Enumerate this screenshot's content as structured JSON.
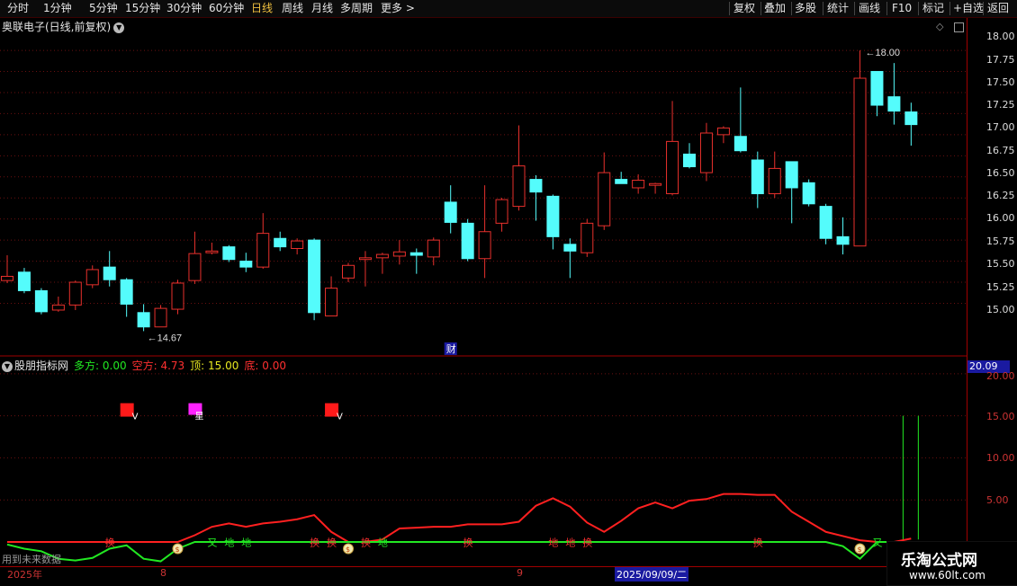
{
  "toolbar": {
    "periods": [
      "分时",
      "1分钟",
      "5分钟",
      "15分钟",
      "30分钟",
      "60分钟",
      "日线",
      "周线",
      "月线",
      "多周期",
      "更多 >"
    ],
    "active_period": "日线",
    "right_buttons": [
      "复权",
      "叠加",
      "多股",
      "统计",
      "画线",
      "F10",
      "标记",
      "+自选",
      "返回"
    ]
  },
  "stock": {
    "title": "奥联电子(日线,前复权)"
  },
  "price_axis": {
    "labels": [
      "18.00",
      "17.75",
      "17.50",
      "17.25",
      "17.00",
      "16.75",
      "16.50",
      "16.25",
      "16.00",
      "15.75",
      "15.50",
      "15.25",
      "15.00"
    ]
  },
  "annotations": {
    "high": "18.00",
    "low": "14.67",
    "finance_badge": "财"
  },
  "indicator": {
    "name": "股朋指标网",
    "duo": "多方: 0.00",
    "kong": "空方: 4.73",
    "ding": "顶: 15.00",
    "di": "底: 0.00",
    "current_value": "20.09",
    "axis_labels": [
      "20.00",
      "15.00",
      "10.00",
      "5.00"
    ],
    "markers": [
      "V",
      "星",
      "V"
    ],
    "signals": [
      "换",
      "又",
      "地",
      "地",
      "换",
      "换",
      "换",
      "地",
      "换",
      "地",
      "地",
      "换",
      "换",
      "又"
    ]
  },
  "footer": {
    "future_data": "用到未来数据",
    "year": "2025年",
    "month8": "8",
    "month9": "9",
    "selected_date": "2025/09/09/二"
  },
  "watermark": {
    "name": "乐淘公式网",
    "url": "www.60lt.com"
  },
  "colors": {
    "up": "#e8302c",
    "down": "#54fcfc",
    "kong_line": "#ff2020",
    "duo_line": "#22e822",
    "grid": "#6a1010"
  },
  "chart_data": {
    "type": "candlestick",
    "candles": [
      {
        "o": 15.27,
        "h": 15.57,
        "l": 15.24,
        "c": 15.32
      },
      {
        "o": 15.37,
        "h": 15.42,
        "l": 15.12,
        "c": 15.15
      },
      {
        "o": 15.15,
        "h": 15.18,
        "l": 14.87,
        "c": 14.9
      },
      {
        "o": 14.92,
        "h": 15.08,
        "l": 14.9,
        "c": 14.98
      },
      {
        "o": 14.98,
        "h": 15.27,
        "l": 14.92,
        "c": 15.25
      },
      {
        "o": 15.22,
        "h": 15.45,
        "l": 15.18,
        "c": 15.4
      },
      {
        "o": 15.43,
        "h": 15.62,
        "l": 15.2,
        "c": 15.28
      },
      {
        "o": 15.28,
        "h": 15.3,
        "l": 14.84,
        "c": 14.99
      },
      {
        "o": 14.89,
        "h": 14.99,
        "l": 14.67,
        "c": 14.72
      },
      {
        "o": 14.72,
        "h": 14.98,
        "l": 14.72,
        "c": 14.94
      },
      {
        "o": 14.93,
        "h": 15.28,
        "l": 14.87,
        "c": 15.24
      },
      {
        "o": 15.27,
        "h": 15.85,
        "l": 15.23,
        "c": 15.59
      },
      {
        "o": 15.6,
        "h": 15.72,
        "l": 15.58,
        "c": 15.62
      },
      {
        "o": 15.67,
        "h": 15.69,
        "l": 15.49,
        "c": 15.52
      },
      {
        "o": 15.5,
        "h": 15.6,
        "l": 15.37,
        "c": 15.43
      },
      {
        "o": 15.43,
        "h": 16.07,
        "l": 15.41,
        "c": 15.83
      },
      {
        "o": 15.77,
        "h": 15.85,
        "l": 15.62,
        "c": 15.67
      },
      {
        "o": 15.65,
        "h": 15.77,
        "l": 15.58,
        "c": 15.74
      },
      {
        "o": 15.75,
        "h": 15.77,
        "l": 14.8,
        "c": 14.89
      },
      {
        "o": 14.85,
        "h": 15.32,
        "l": 14.85,
        "c": 15.18
      },
      {
        "o": 15.3,
        "h": 15.48,
        "l": 15.25,
        "c": 15.45
      },
      {
        "o": 15.52,
        "h": 15.62,
        "l": 15.2,
        "c": 15.54
      },
      {
        "o": 15.54,
        "h": 15.6,
        "l": 15.35,
        "c": 15.58
      },
      {
        "o": 15.56,
        "h": 15.75,
        "l": 15.46,
        "c": 15.61
      },
      {
        "o": 15.6,
        "h": 15.65,
        "l": 15.35,
        "c": 15.57
      },
      {
        "o": 15.55,
        "h": 15.78,
        "l": 15.45,
        "c": 15.75
      },
      {
        "o": 16.2,
        "h": 16.4,
        "l": 15.83,
        "c": 15.96
      },
      {
        "o": 15.95,
        "h": 16.0,
        "l": 15.5,
        "c": 15.53
      },
      {
        "o": 15.53,
        "h": 16.4,
        "l": 15.3,
        "c": 15.85
      },
      {
        "o": 15.95,
        "h": 16.25,
        "l": 15.85,
        "c": 16.23
      },
      {
        "o": 16.15,
        "h": 17.11,
        "l": 16.1,
        "c": 16.63
      },
      {
        "o": 16.47,
        "h": 16.52,
        "l": 15.98,
        "c": 16.32
      },
      {
        "o": 16.27,
        "h": 16.29,
        "l": 15.64,
        "c": 15.79
      },
      {
        "o": 15.7,
        "h": 15.77,
        "l": 15.3,
        "c": 15.62
      },
      {
        "o": 15.6,
        "h": 16.0,
        "l": 15.55,
        "c": 15.95
      },
      {
        "o": 15.92,
        "h": 16.79,
        "l": 15.87,
        "c": 16.55
      },
      {
        "o": 16.47,
        "h": 16.56,
        "l": 16.42,
        "c": 16.42
      },
      {
        "o": 16.37,
        "h": 16.53,
        "l": 16.3,
        "c": 16.46
      },
      {
        "o": 16.4,
        "h": 16.43,
        "l": 16.3,
        "c": 16.42
      },
      {
        "o": 16.3,
        "h": 17.4,
        "l": 16.28,
        "c": 16.92
      },
      {
        "o": 16.77,
        "h": 16.9,
        "l": 16.6,
        "c": 16.62
      },
      {
        "o": 16.55,
        "h": 17.14,
        "l": 16.45,
        "c": 17.02
      },
      {
        "o": 17.0,
        "h": 17.1,
        "l": 16.9,
        "c": 17.08
      },
      {
        "o": 16.98,
        "h": 17.56,
        "l": 16.79,
        "c": 16.81
      },
      {
        "o": 16.7,
        "h": 16.8,
        "l": 16.13,
        "c": 16.3
      },
      {
        "o": 16.3,
        "h": 16.8,
        "l": 16.25,
        "c": 16.6
      },
      {
        "o": 16.68,
        "h": 16.68,
        "l": 15.95,
        "c": 16.37
      },
      {
        "o": 16.43,
        "h": 16.47,
        "l": 16.15,
        "c": 16.18
      },
      {
        "o": 16.15,
        "h": 16.18,
        "l": 15.7,
        "c": 15.77
      },
      {
        "o": 15.79,
        "h": 16.02,
        "l": 15.58,
        "c": 15.7
      },
      {
        "o": 15.68,
        "h": 18.0,
        "l": 15.68,
        "c": 17.67
      },
      {
        "o": 17.75,
        "h": 17.75,
        "l": 17.22,
        "c": 17.35
      },
      {
        "o": 17.45,
        "h": 17.85,
        "l": 17.12,
        "c": 17.28
      },
      {
        "o": 17.27,
        "h": 17.38,
        "l": 16.87,
        "c": 17.12
      }
    ],
    "kong_line": [
      0,
      0,
      0,
      0,
      0,
      0,
      0,
      0,
      0,
      0,
      0,
      0.8,
      1.8,
      2.2,
      1.8,
      2.2,
      2.4,
      2.7,
      3.2,
      1.2,
      0,
      0,
      0.3,
      1.6,
      1.7,
      1.8,
      1.8,
      2.1,
      2.1,
      2.1,
      2.4,
      4.3,
      5.2,
      4.2,
      2.3,
      1.2,
      2.5,
      4.0,
      4.7,
      4.0,
      4.9,
      5.1,
      5.7,
      5.7,
      5.6,
      5.6,
      3.6,
      2.4,
      1.2,
      0.7,
      0.2,
      0,
      0,
      0.4,
      6.3,
      4.7
    ],
    "duo_line": [
      -0.3,
      -0.8,
      -1.1,
      -2.0,
      -2.2,
      -1.9,
      -0.8,
      -0.4,
      -2.0,
      -2.3,
      -0.8,
      0,
      0,
      0,
      0,
      0,
      0,
      0,
      0,
      0,
      0,
      0,
      0,
      0,
      0,
      0,
      0,
      0,
      0,
      0,
      0,
      0,
      0,
      0,
      0,
      0,
      0,
      0,
      0,
      0,
      0,
      0,
      0,
      0,
      0,
      0,
      0,
      0,
      0,
      -0.5,
      -2.0,
      0,
      0,
      0,
      0,
      0
    ],
    "ylim_price": [
      14.6,
      18.15
    ],
    "ylim_indicator": [
      0,
      20.09
    ]
  }
}
